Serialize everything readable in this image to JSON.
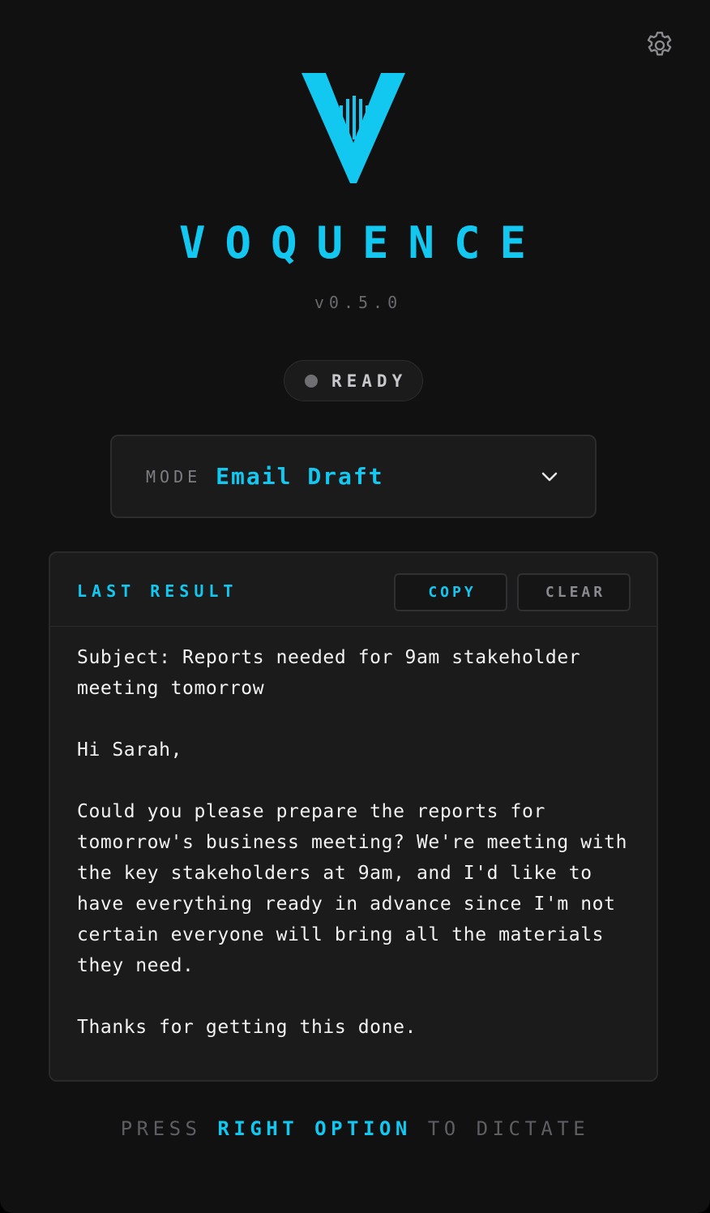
{
  "app": {
    "name": "VOQUENCE",
    "version": "v0.5.0"
  },
  "status": {
    "label": "READY",
    "dot_color": "#6f6f72"
  },
  "mode": {
    "label": "MODE",
    "value": "Email Draft"
  },
  "result": {
    "title": "LAST RESULT",
    "copy_label": "COPY",
    "clear_label": "CLEAR",
    "paragraphs": [
      "Subject: Reports needed for 9am stakeholder meeting tomorrow",
      "Hi Sarah,",
      "Could you please prepare the reports for tomorrow's business meeting? We're meeting with the key stakeholders at 9am, and I'd like to have everything ready in advance since I'm not certain everyone will bring all the materials they need.",
      "Thanks for getting this done."
    ]
  },
  "hint": {
    "prefix": "PRESS",
    "key": "RIGHT OPTION",
    "suffix": "TO DICTATE"
  },
  "icons": {
    "settings": "gear-icon",
    "dropdown": "chevron-down-icon",
    "logo": "voquence-logo"
  },
  "colors": {
    "accent": "#12c8f0",
    "background": "#111112",
    "panel": "#1b1b1c"
  }
}
